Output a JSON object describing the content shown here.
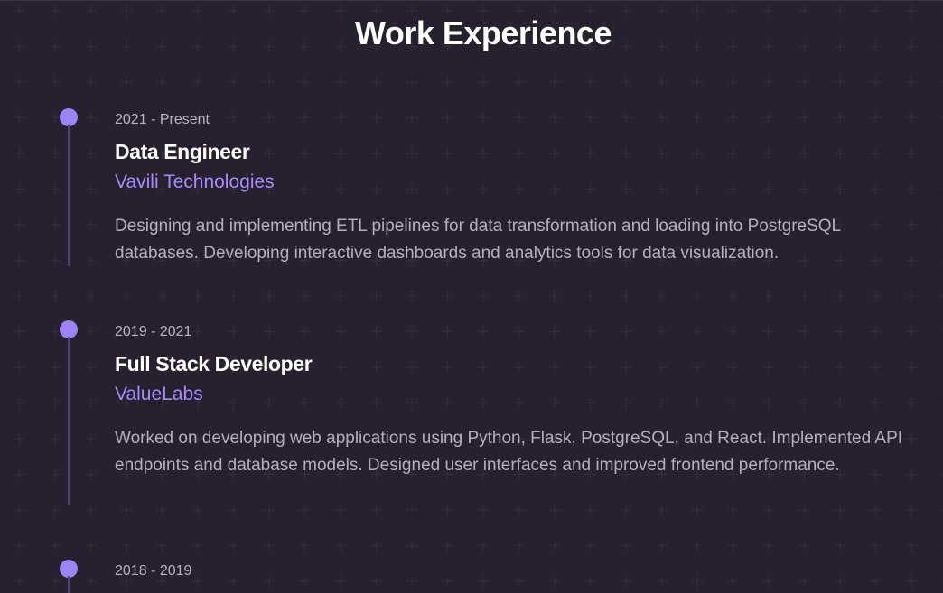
{
  "page": {
    "title": "Work Experience",
    "background": "#15111f",
    "accent": "#a78bfa"
  },
  "experience": [
    {
      "period": "2021 - Present",
      "role": "Data Engineer",
      "company": "Vavili Technologies",
      "description": "Designing and implementing ETL pipelines for data transformation and loading into PostgreSQL databases. Developing interactive dashboards and analytics tools for data visualization."
    },
    {
      "period": "2019 - 2021",
      "role": "Full Stack Developer",
      "company": "ValueLabs",
      "description": "Worked on developing web applications using Python, Flask, PostgreSQL, and React. Implemented API endpoints and database models. Designed user interfaces and improved frontend performance."
    },
    {
      "period": "2018 - 2019"
    }
  ]
}
